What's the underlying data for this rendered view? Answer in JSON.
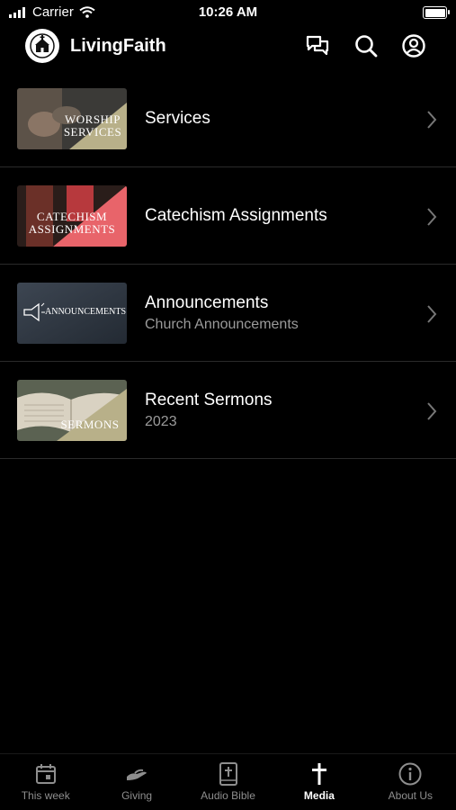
{
  "status_bar": {
    "carrier": "Carrier",
    "time": "10:26 AM"
  },
  "header": {
    "app_title": "LivingFaith",
    "icons": [
      "chat-icon",
      "search-icon",
      "account-icon"
    ]
  },
  "media_list": [
    {
      "title": "Services",
      "subtitle": "",
      "thumb_text": [
        "WORSHIP",
        "SERVICES"
      ]
    },
    {
      "title": "Catechism Assignments",
      "subtitle": "",
      "thumb_text": [
        "CATECHISM",
        "ASSIGNMENTS"
      ]
    },
    {
      "title": "Announcements",
      "subtitle": "Church Announcements",
      "thumb_text": [
        "ANNOUNCEMENTS"
      ]
    },
    {
      "title": "Recent Sermons",
      "subtitle": "2023",
      "thumb_text": [
        "SERMONS"
      ]
    }
  ],
  "tabs": [
    {
      "label": "This week",
      "icon": "calendar-icon",
      "active": false
    },
    {
      "label": "Giving",
      "icon": "giving-hand-icon",
      "active": false
    },
    {
      "label": "Audio Bible",
      "icon": "bible-icon",
      "active": false
    },
    {
      "label": "Media",
      "icon": "cross-icon",
      "active": true
    },
    {
      "label": "About Us",
      "icon": "info-icon",
      "active": false
    }
  ]
}
